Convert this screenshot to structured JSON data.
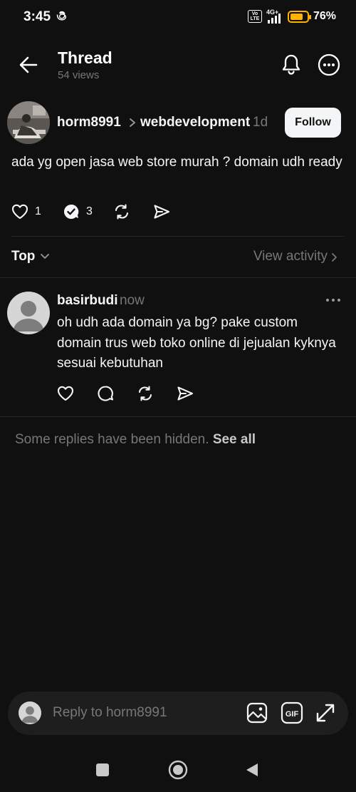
{
  "status_bar": {
    "time": "3:45",
    "volte": "Vo LTE",
    "network": "4G+",
    "battery_percent": "76%",
    "battery_level": 0.76
  },
  "header": {
    "title": "Thread",
    "views": "54 views"
  },
  "post": {
    "username": "horm8991",
    "topic": "webdevelopment",
    "time": "1d",
    "follow_label": "Follow",
    "text": "ada yg open jasa web store murah ? domain udh ready",
    "like_count": "1",
    "reply_count": "3"
  },
  "sort": {
    "label": "Top",
    "activity_label": "View activity"
  },
  "reply": {
    "username": "basirbudi",
    "time": "now",
    "text": "oh udh ada domain ya bg? pake custom domain trus web toko online di jejualan kyknya sesuai kebutuhan"
  },
  "hidden_notice": {
    "text": "Some replies have been hidden.",
    "link": "See all"
  },
  "composer": {
    "placeholder": "Reply to horm8991",
    "gif_label": "GIF"
  },
  "colors": {
    "background": "#101010",
    "text": "#f3f5f7",
    "muted": "#777777",
    "battery": "#ffb300"
  }
}
